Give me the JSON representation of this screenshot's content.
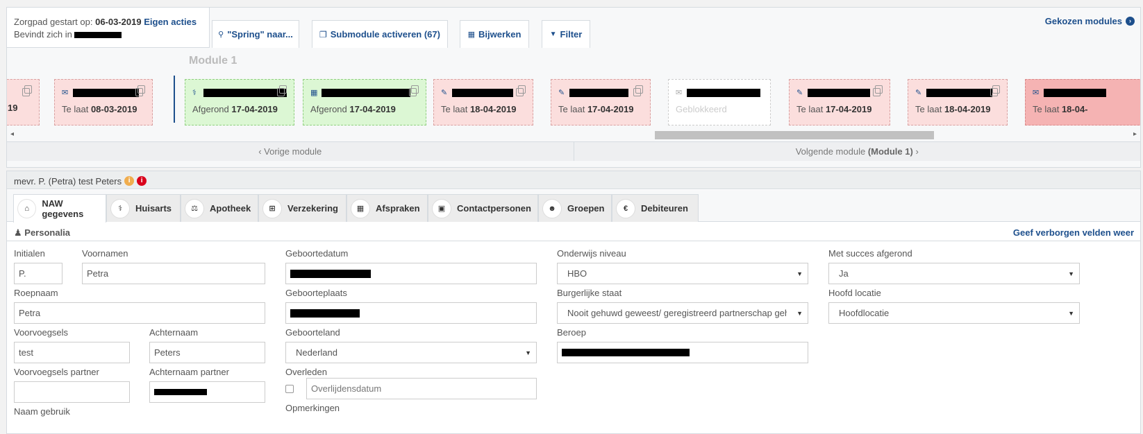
{
  "status": {
    "started_label": "Zorgpad gestart op:",
    "started_date": "06-03-2019",
    "own_actions": "Eigen acties",
    "location_label": "Bevindt zich in"
  },
  "toolbar": {
    "spring": "\"Spring\" naar...",
    "submodule": "Submodule activeren (67)",
    "update": "Bijwerken",
    "filter": "Filter",
    "chosen_modules": "Gekozen modules"
  },
  "module": {
    "title": "Module 1",
    "prev": "Vorige module",
    "next_prefix": "Volgende module",
    "next_name": "(Module 1)"
  },
  "cards": [
    {
      "state": "late",
      "prefix": "",
      "date": "19"
    },
    {
      "state": "late",
      "prefix": "Te laat",
      "date": "08-03-2019"
    },
    {
      "state": "done",
      "prefix": "Afgerond",
      "date": "17-04-2019"
    },
    {
      "state": "done",
      "prefix": "Afgerond",
      "date": "17-04-2019"
    },
    {
      "state": "late",
      "prefix": "Te laat",
      "date": "18-04-2019"
    },
    {
      "state": "late",
      "prefix": "Te laat",
      "date": "17-04-2019"
    },
    {
      "state": "blocked",
      "prefix": "Geblokkeerd",
      "date": ""
    },
    {
      "state": "late",
      "prefix": "Te laat",
      "date": "17-04-2019"
    },
    {
      "state": "late",
      "prefix": "Te laat",
      "date": "18-04-2019"
    },
    {
      "state": "late",
      "prefix": "Te laat",
      "date": "18-04-"
    }
  ],
  "patient": {
    "name": "mevr. P. (Petra) test Peters"
  },
  "tabs": [
    {
      "label": "NAW gegevens"
    },
    {
      "label": "Huisarts"
    },
    {
      "label": "Apotheek"
    },
    {
      "label": "Verzekering"
    },
    {
      "label": "Afspraken"
    },
    {
      "label": "Contactpersonen"
    },
    {
      "label": "Groepen"
    },
    {
      "label": "Debiteuren"
    }
  ],
  "section": {
    "title": "Personalia",
    "show_hidden": "Geef verborgen velden weer"
  },
  "form": {
    "initials_label": "Initialen",
    "initials": "P.",
    "firstnames_label": "Voornamen",
    "firstnames": "Petra",
    "callname_label": "Roepnaam",
    "callname": "Petra",
    "prefix_label": "Voorvoegsels",
    "prefix": "test",
    "lastname_label": "Achternaam",
    "lastname": "Peters",
    "partner_prefix_label": "Voorvoegsels partner",
    "partner_prefix": "",
    "partner_lastname_label": "Achternaam partner",
    "name_use_label": "Naam gebruik",
    "birthdate_label": "Geboortedatum",
    "birthplace_label": "Geboorteplaats",
    "birthcountry_label": "Geboorteland",
    "birthcountry": "Nederland",
    "deceased_label": "Overleden",
    "deceased_placeholder": "Overlijdensdatum",
    "remarks_label": "Opmerkingen",
    "education_label": "Onderwijs niveau",
    "education": "HBO",
    "marital_label": "Burgerlijke staat",
    "marital": "Nooit gehuwd geweest/ geregistreerd partnerschap geh",
    "profession_label": "Beroep",
    "success_label": "Met succes afgerond",
    "success": "Ja",
    "location_label": "Hoofd locatie",
    "location": "Hoofdlocatie"
  },
  "colors": {
    "link": "#1d4f8c",
    "late_bg": "#fbdedd",
    "done_bg": "#dcf7d4",
    "info_orange": "#f0ad4e",
    "info_red": "#d9001b"
  }
}
